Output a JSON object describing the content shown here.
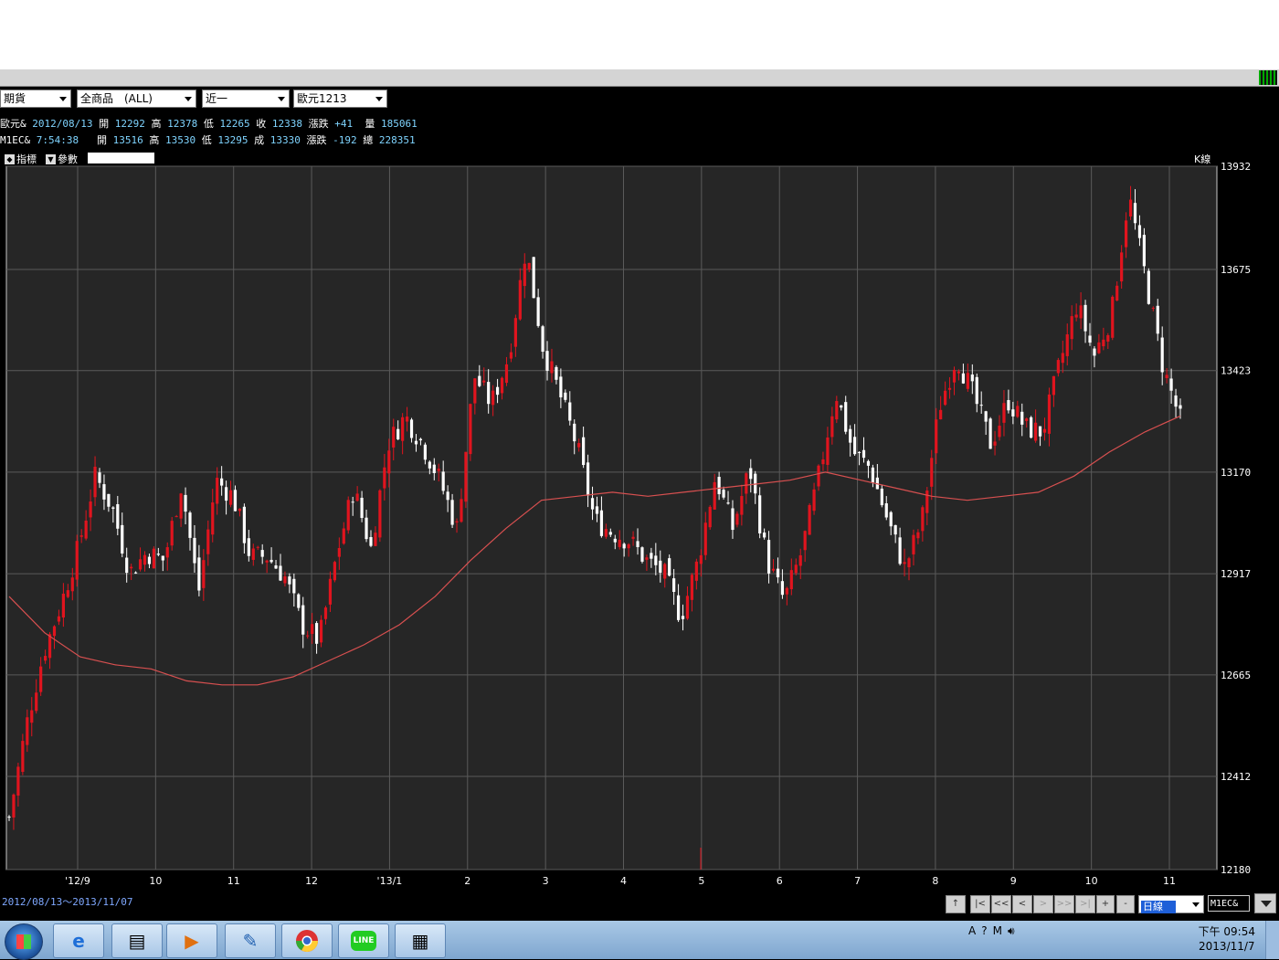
{
  "filters": {
    "market": "期貨",
    "product": "全商品　(ALL)",
    "range": "近一",
    "contract": "歐元1213"
  },
  "quote1": {
    "name": "歐元&",
    "date": "2012/08/13",
    "open_label": "開",
    "open": "12292",
    "high_label": "高",
    "high": "12378",
    "low_label": "低",
    "low": "12265",
    "close_label": "收",
    "close": "12338",
    "chg_label": "漲跌",
    "chg": "+41",
    "vol_label": "量",
    "vol": "185061"
  },
  "quote2": {
    "name": "M1EC&",
    "time": "7:54:38",
    "open_label": "開",
    "open": "13516",
    "high_label": "高",
    "high": "13530",
    "low_label": "低",
    "low": "13295",
    "close_label": "成",
    "close": "13330",
    "chg_label": "漲跌",
    "chg": "-192",
    "vol_label": "總",
    "vol": "228351"
  },
  "toolbar": {
    "indicator_label": "指標",
    "param_label": "參數",
    "chart_type_label": "K線"
  },
  "chart_data": {
    "type": "candlestick",
    "y_ticks": [
      "13932",
      "13675",
      "13423",
      "13170",
      "12917",
      "12665",
      "12412",
      "12180"
    ],
    "ylim": [
      12180,
      13932
    ],
    "x_ticks": [
      "'12/9",
      "10",
      "11",
      "12",
      "'13/1",
      "2",
      "3",
      "4",
      "5",
      "6",
      "7",
      "8",
      "9",
      "10",
      "11"
    ],
    "moving_average_color": "#d85050",
    "up_color": "#e0141e",
    "down_color": "#ffffff",
    "grid": true,
    "series": [
      {
        "values": [
          12310,
          12540,
          12720,
          12840,
          12980,
          13160,
          13080,
          12920,
          12970,
          12950,
          13140,
          12870,
          13150,
          13110,
          12960,
          12960,
          12910,
          12790,
          12750,
          12960,
          13130,
          12980,
          13240,
          13310,
          13240,
          13150,
          13030,
          13410,
          13340,
          13460,
          13730,
          13480,
          13360,
          13230,
          13050,
          13020,
          13000,
          12950,
          12920,
          12810,
          12950,
          13160,
          13030,
          13180,
          12950,
          12850,
          12970,
          13160,
          13370,
          13220,
          13180,
          13050,
          12930,
          13050,
          13330,
          13460,
          13360,
          13240,
          13350,
          13280,
          13270,
          13440,
          13590,
          13460,
          13560,
          13860,
          13650,
          13430,
          13300
        ]
      }
    ],
    "moving_average": [
      12860,
      12770,
      12710,
      12690,
      12680,
      12650,
      12640,
      12640,
      12660,
      12700,
      12740,
      12790,
      12860,
      12950,
      13030,
      13100,
      13110,
      13120,
      13110,
      13120,
      13130,
      13140,
      13150,
      13170,
      13150,
      13130,
      13110,
      13100,
      13110,
      13120,
      13160,
      13220,
      13270,
      13310
    ]
  },
  "footer": {
    "date_range": "2012/08/13～2013/11/07",
    "up_button": "↑",
    "nav_buttons": [
      "|<",
      "<<",
      "<",
      ">",
      ">>",
      ">|"
    ],
    "zoom_in": "+",
    "zoom_out": "-",
    "period": "日線",
    "symbol": "M1EC&"
  },
  "taskbar": {
    "clock_time": "下午 09:54",
    "clock_date": "2013/11/7",
    "tray_items": [
      "A",
      "?",
      "M"
    ],
    "apps": [
      "ie-icon",
      "explorer-icon",
      "media-player-icon",
      "paint-icon",
      "chrome-icon",
      "line-icon",
      "calculator-icon"
    ],
    "line_label": "LINE"
  }
}
